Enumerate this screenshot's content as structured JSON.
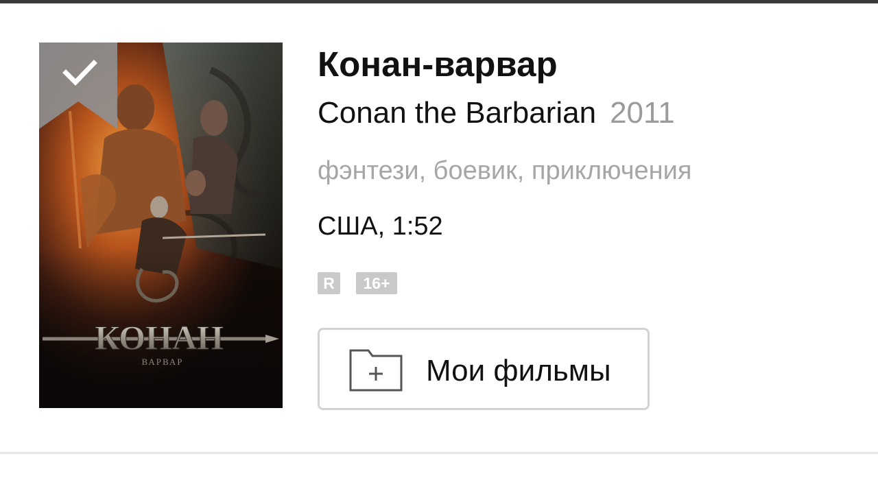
{
  "movie": {
    "title_ru": "Конан-варвар",
    "title_original": "Conan the Barbarian",
    "year": "2011",
    "genres": "фэнтези, боевик, приключения",
    "country_duration": "США, 1:52",
    "rating_badge": "R",
    "age_badge": "16+"
  },
  "poster": {
    "logo_text": "КОНАН",
    "logo_subtext": "ВАРВАР",
    "watched": true
  },
  "actions": {
    "add_to_list_label": "Мои фильмы"
  },
  "icons": {
    "bookmark": "check-bookmark-icon",
    "folder": "folder-plus-icon"
  },
  "colors": {
    "top_bar": "#3a3a3a",
    "title": "#111111",
    "muted": "#a6a6a6",
    "badge": "#c9c9c9",
    "button_border": "#d2d2d2"
  }
}
